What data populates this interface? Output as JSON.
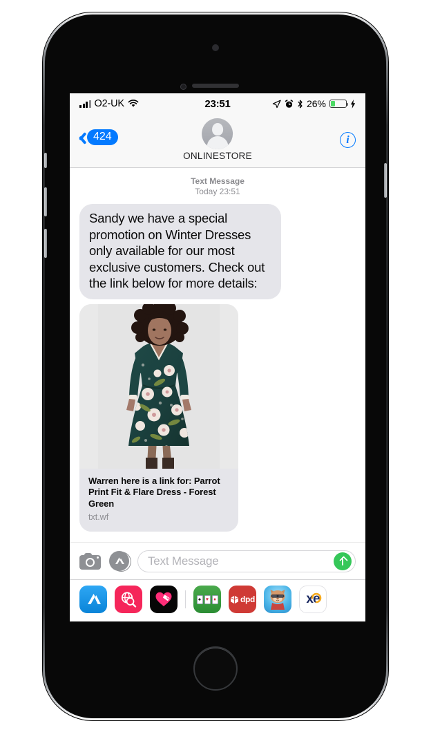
{
  "device": {
    "label": "iphone-mockup"
  },
  "status_bar": {
    "carrier": "O2-UK",
    "wifi_icon": "wifi-icon",
    "time": "23:51",
    "location_icon": "location-arrow-icon",
    "alarm_icon": "alarm-clock-icon",
    "bluetooth_icon": "bluetooth-icon",
    "battery_percent": "26%",
    "battery_level": 26,
    "charging_icon": "lightning-bolt-icon"
  },
  "nav_bar": {
    "back_badge": "424",
    "back_icon": "chevron-left-icon",
    "contact_name": "ONLINESTORE",
    "avatar_icon": "person-avatar-icon",
    "info_label": "i"
  },
  "conversation": {
    "timestamp_label": "Text Message",
    "timestamp_value": "Today 23:51",
    "messages": [
      {
        "type": "text",
        "sender": "them",
        "body": "Sandy we have a special promotion on Winter Dresses only available for our most exclusive customers. Check out the link below for more details:"
      },
      {
        "type": "link-preview",
        "sender": "them",
        "title": "Warren here is a link for: Parrot Print Fit & Flare Dress - Forest Green",
        "domain": "txt.wf",
        "image_alt": "Model wearing dark green floral print fit and flare dress"
      }
    ]
  },
  "input_bar": {
    "camera_icon": "camera-icon",
    "appstore_icon": "app-store-icon",
    "placeholder": "Text Message",
    "value": "",
    "send_icon": "send-arrow-up-icon",
    "send_color": "#35c759"
  },
  "app_drawer": {
    "items": [
      {
        "name": "app-store",
        "label": "App Store",
        "color": "#2ea7f4"
      },
      {
        "name": "image-search",
        "label": "Image Search",
        "color": "#f5265a"
      },
      {
        "name": "digital-touch",
        "label": "Digital Touch",
        "color": "#060606"
      },
      {
        "name": "solitaire",
        "label": "Solitaire",
        "color": "#4aa94c"
      },
      {
        "name": "dpd",
        "label": "dpd",
        "color": "#cf3a35"
      },
      {
        "name": "talking-tom",
        "label": "Talking Tom",
        "color": "#4db6e8"
      },
      {
        "name": "xe",
        "label": "xe",
        "color": "#1b2a62"
      }
    ]
  },
  "colors": {
    "accent_blue": "#047aff",
    "bubble_gray": "#e5e5ea",
    "send_green": "#35c759",
    "battery_green": "#4cd964",
    "muted_text": "#8e8e93"
  }
}
